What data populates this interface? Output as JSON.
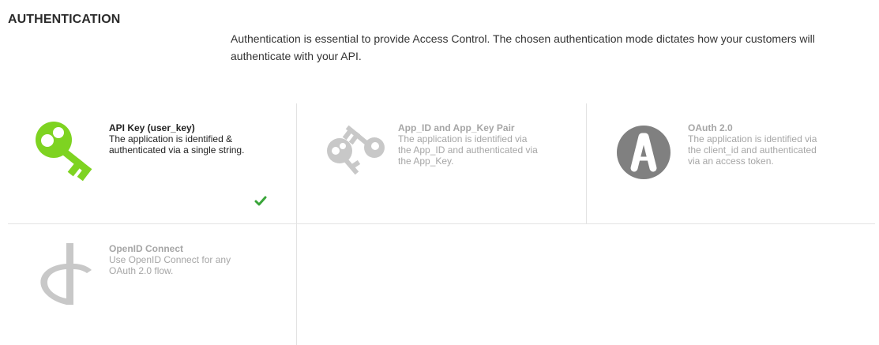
{
  "section": {
    "title": "AUTHENTICATION",
    "description": "Authentication is essential to provide Access Control. The chosen authentication mode dictates how your customers will authenticate with your API."
  },
  "options": [
    {
      "name": "API Key (user_key)",
      "description": "The application is identified & authenticated via a single string.",
      "icon": "key-icon",
      "selected": true
    },
    {
      "name": "App_ID and App_Key Pair",
      "description": "The application is identified via the App_ID and authenticated via the App_Key.",
      "icon": "key-pair-icon",
      "selected": false
    },
    {
      "name": "OAuth 2.0",
      "description": "The application is identified via the client_id and authenticated via an access token.",
      "icon": "oauth-icon",
      "selected": false
    },
    {
      "name": "OpenID Connect",
      "description": "Use OpenID Connect for any OAuth 2.0 flow.",
      "icon": "openid-icon",
      "selected": false
    }
  ],
  "colors": {
    "accent_green": "#7ed321",
    "check_green": "#3aa53a",
    "inactive_gray": "#c8c8c8",
    "oauth_gray": "#808080"
  }
}
